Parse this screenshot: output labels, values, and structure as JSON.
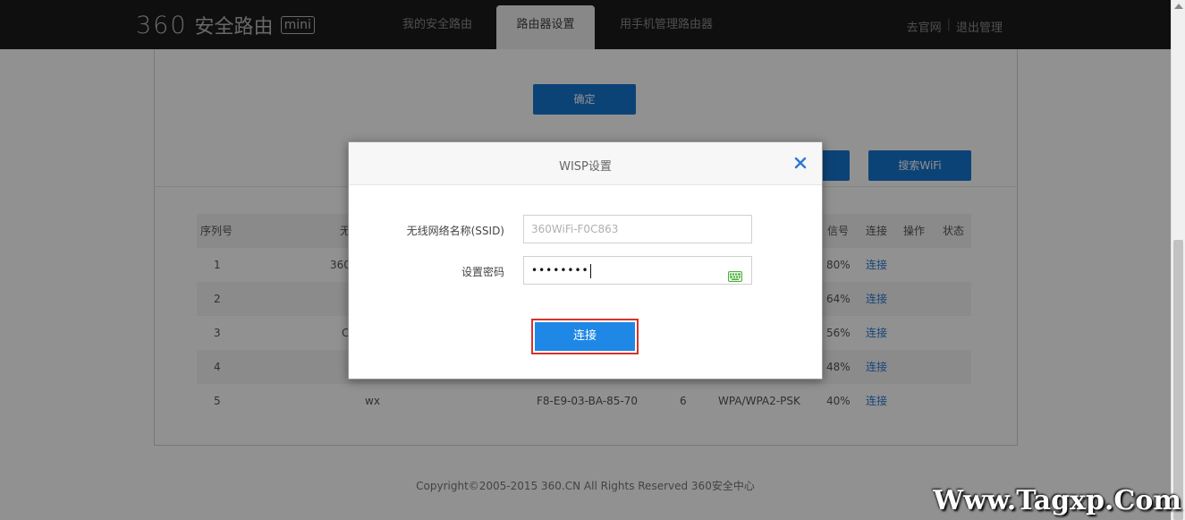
{
  "header": {
    "logo_num": "360",
    "logo_text": "安全路由",
    "logo_badge": "mini",
    "tabs": [
      {
        "label": "我的安全路由",
        "active": false
      },
      {
        "label": "路由器设置",
        "active": true
      },
      {
        "label": "用手机管理路由器",
        "active": false
      }
    ],
    "official_site": "去官网",
    "separator": "|",
    "logout": "退出管理"
  },
  "page": {
    "confirm_button": "确定",
    "search_wifi_button": "搜索WiFi"
  },
  "table": {
    "headers": [
      "序列号",
      "无",
      "信号",
      "连接",
      "操作",
      "状态"
    ],
    "rows": [
      {
        "index": "1",
        "name": "360",
        "mac": "",
        "channel": "",
        "security": "",
        "signal": "80%",
        "connect": "连接"
      },
      {
        "index": "2",
        "name": "",
        "mac": "",
        "channel": "",
        "security": "",
        "signal": "64%",
        "connect": "连接"
      },
      {
        "index": "3",
        "name": "C",
        "mac": "",
        "channel": "",
        "security": "",
        "signal": "56%",
        "connect": "连接"
      },
      {
        "index": "4",
        "name": "",
        "mac": "",
        "channel": "",
        "security": "",
        "signal": "48%",
        "connect": "连接"
      },
      {
        "index": "5",
        "name": "wx",
        "mac": "F8-E9-03-BA-85-70",
        "channel": "6",
        "security": "WPA/WPA2-PSK",
        "signal": "40%",
        "connect": "连接"
      }
    ]
  },
  "footer": {
    "copyright": "Copyright©2005-2015 360.CN All Rights Reserved 360安全中心"
  },
  "modal": {
    "title": "WISP设置",
    "ssid_label": "无线网络名称(SSID)",
    "ssid_value": "360WiFi-F0C863",
    "password_label": "设置密码",
    "password_value": "••••••••",
    "connect_button": "连接"
  },
  "watermark": "Www.Tagxp.Com",
  "colors": {
    "accent": "#1677d2",
    "highlight_border": "#d5332c",
    "topbar": "#1c1c1c"
  }
}
